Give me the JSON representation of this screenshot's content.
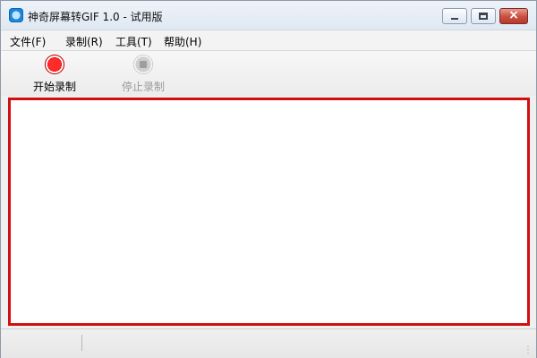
{
  "window": {
    "title": "神奇屏幕转GIF 1.0 - 试用版",
    "close_glyph": "×"
  },
  "menu": {
    "items": [
      {
        "label": "文件(F)"
      },
      {
        "label": "录制(R)"
      },
      {
        "label": "工具(T)"
      },
      {
        "label": "帮助(H)"
      }
    ]
  },
  "toolbar": {
    "start_record_label": "开始录制",
    "stop_record_label": "停止录制"
  },
  "icons": {
    "app": "screen-gif-app-icon",
    "start": "record-icon",
    "stop": "stop-icon"
  },
  "colors": {
    "capture_border": "#d10f0f",
    "record_red": "#ff2b2b",
    "disabled_gray": "#9a9a9a"
  }
}
